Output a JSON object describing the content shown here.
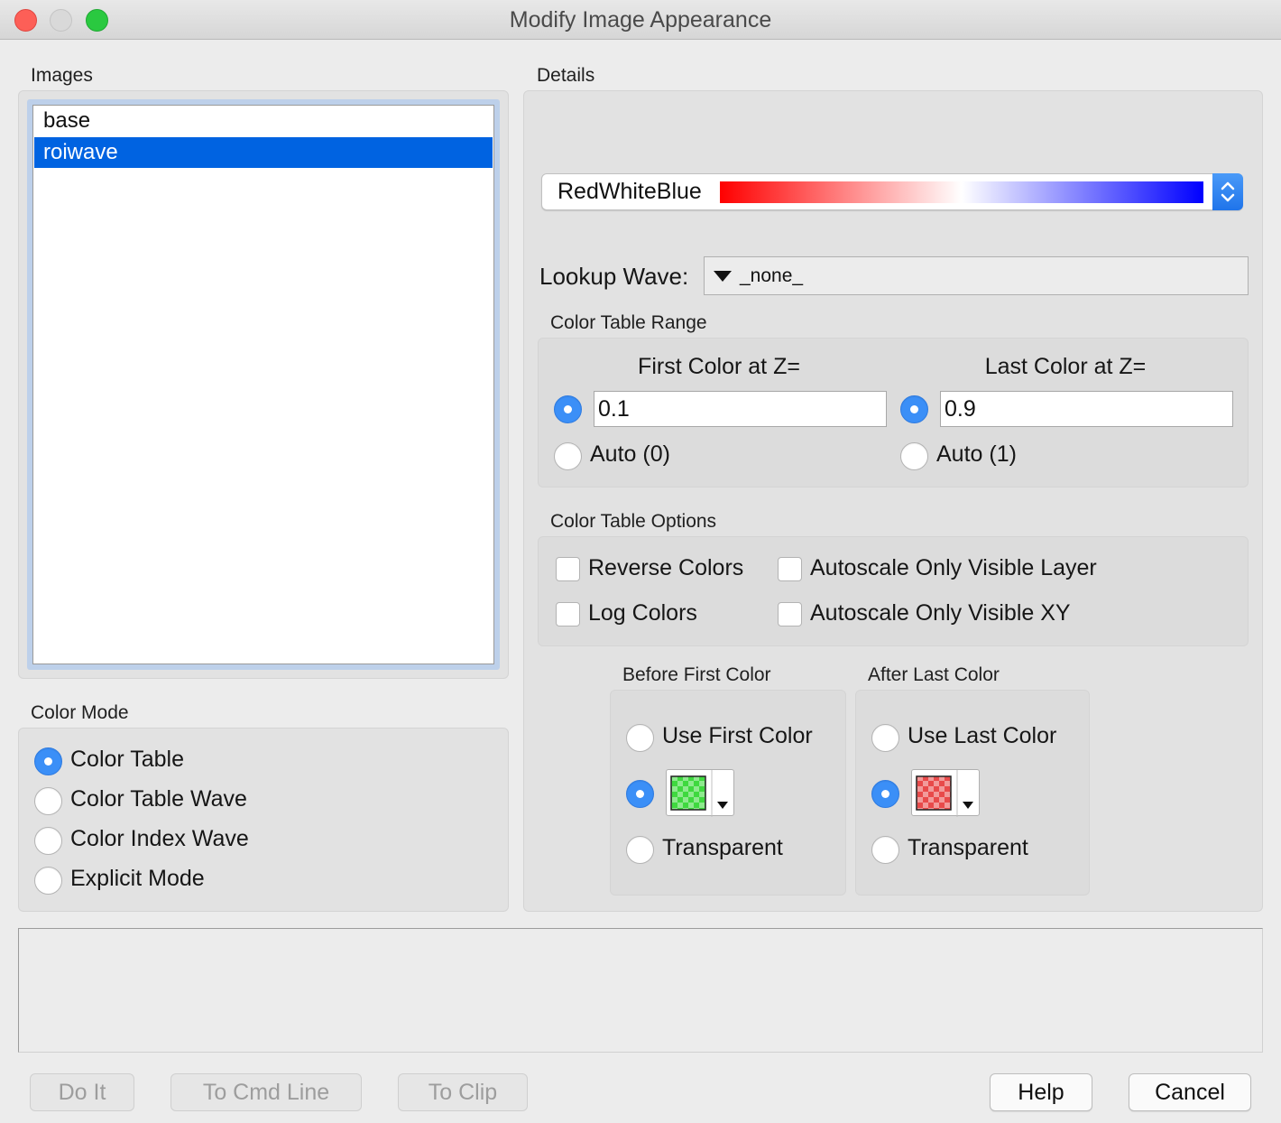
{
  "window": {
    "title": "Modify Image Appearance"
  },
  "images": {
    "label": "Images",
    "items": [
      {
        "name": "base",
        "selected": false
      },
      {
        "name": "roiwave",
        "selected": true
      }
    ]
  },
  "color_mode": {
    "label": "Color Mode",
    "options": [
      {
        "label": "Color Table",
        "selected": true
      },
      {
        "label": "Color Table Wave",
        "selected": false
      },
      {
        "label": "Color Index Wave",
        "selected": false
      },
      {
        "label": "Explicit Mode",
        "selected": false
      }
    ]
  },
  "details": {
    "label": "Details",
    "color_table": {
      "name": "RedWhiteBlue",
      "gradient": [
        "#ff0000",
        "#ffffff",
        "#0000ff"
      ]
    },
    "lookup_wave": {
      "label": "Lookup Wave:",
      "value": "_none_"
    },
    "range": {
      "label": "Color Table Range",
      "first_header": "First Color at Z=",
      "last_header": "Last Color at Z=",
      "first_value": "0.1",
      "last_value": "0.9",
      "first_auto": "Auto (0)",
      "last_auto": "Auto (1)"
    },
    "options": {
      "label": "Color Table Options",
      "reverse_colors": "Reverse Colors",
      "log_colors": "Log Colors",
      "autoscale_visible_layer": "Autoscale Only Visible Layer",
      "autoscale_visible_xy": "Autoscale Only Visible XY"
    },
    "before_first": {
      "label": "Before First Color",
      "use_first": "Use First Color",
      "transparent": "Transparent",
      "swatch_color": "#3fd93f"
    },
    "after_last": {
      "label": "After Last Color",
      "use_last": "Use Last Color",
      "transparent": "Transparent",
      "swatch_color": "#e84a4a"
    }
  },
  "buttons": {
    "do_it": "Do It",
    "to_cmd_line": "To Cmd Line",
    "to_clip": "To Clip",
    "help": "Help",
    "cancel": "Cancel"
  }
}
